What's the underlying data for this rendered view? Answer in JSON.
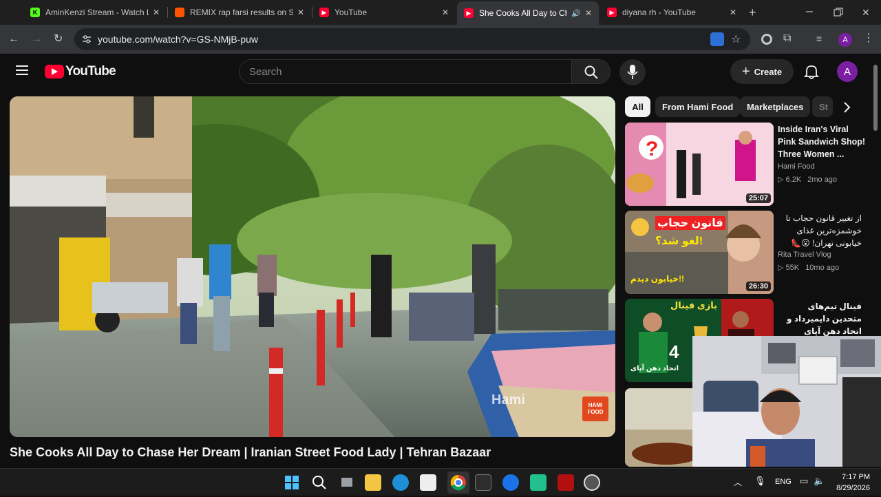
{
  "browser": {
    "tabs": [
      {
        "title": "AminKenzi Stream - Watch Live",
        "fav_color": "#53fc18",
        "fav_glyph": "K"
      },
      {
        "title": "REMIX rap farsi results on SoundCloud",
        "fav_color": "#ff5500",
        "fav_glyph": ""
      },
      {
        "title": "YouTube",
        "fav_color": "#ff0033",
        "fav_glyph": "▶"
      },
      {
        "title": "She Cooks All Day to Chase Her Dream",
        "fav_color": "#ff0033",
        "fav_glyph": "▶"
      },
      {
        "title": "diyana rh - YouTube",
        "fav_color": "#ff0033",
        "fav_glyph": "▶"
      }
    ],
    "url": "youtube.com/watch?v=GS-NMjB-puw",
    "profile_letter": "A"
  },
  "youtube": {
    "logo_text": "YouTube",
    "search_placeholder": "Search",
    "create_label": "Create",
    "avatar_letter": "A"
  },
  "video": {
    "title": "She Cooks All Day to Chase Her Dream | Iranian Street Food Lady | Tehran Bazaar",
    "watermark": "Hami",
    "badge_line1": "HAMI",
    "badge_line2": "FOOD"
  },
  "chips": [
    "All",
    "From Hami Food",
    "Marketplaces",
    "St"
  ],
  "recommendations": [
    {
      "title": "Inside Iran's Viral Pink Sandwich Shop! Three Women ...",
      "channel": "Hami Food",
      "views": "6.2K",
      "age": "2mo ago",
      "duration": "25:07"
    },
    {
      "title": "از تغییر قانون حجاب تا خوشمزه‌ترین غذای خیابونی تهران! 😮👠",
      "channel": "Rita Travel Vlog",
      "views": "55K",
      "age": "10mo ago",
      "duration": "26:30",
      "thumb_text_1": "قانون حجاب",
      "thumb_text_2": "لغو شد؟!",
      "thumb_text_3": "خیابون دیدم!!"
    },
    {
      "title": "فینال تیم‌های متحدین دایمیرداد و اتحاد دهن آپای #اکسپلور viral #foryou# ...",
      "thumb_text_1": "بازی فینال",
      "thumb_text_2": "اتحاد دهن آپای",
      "thumb_number": "4"
    }
  ],
  "taskbar": {
    "lang": "ENG",
    "time": "7:17 PM",
    "date": "8/29/2026"
  },
  "colors": {
    "accent_red": "#ff0033",
    "avatar_purple": "#7b1fa2",
    "chip_bg": "#272727"
  }
}
